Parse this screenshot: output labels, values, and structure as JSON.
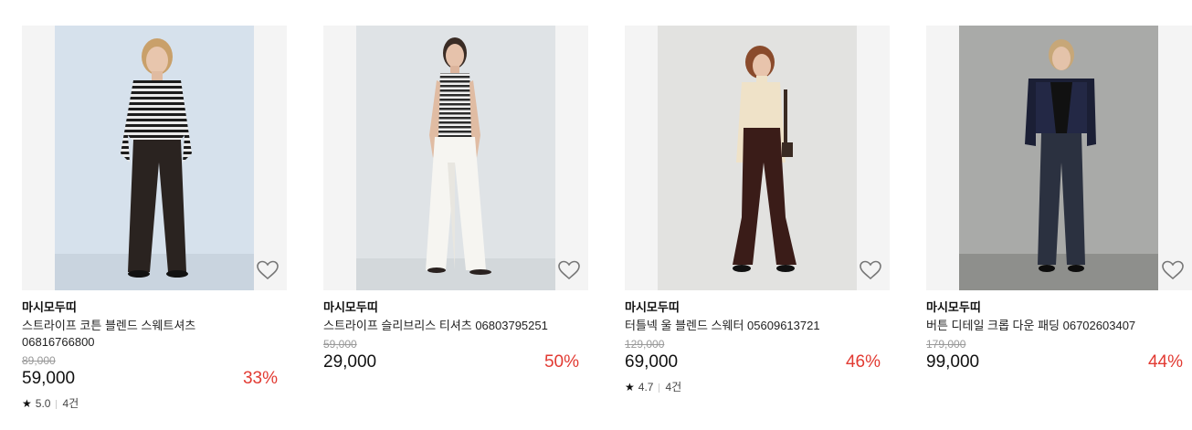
{
  "colors": {
    "discount": "#e23a32",
    "strike": "#999999",
    "thumb_bg": "#f4f4f4"
  },
  "products": [
    {
      "brand": "마시모두띠",
      "name": "스트라이프 코튼 블렌드 스웨트셔츠 06816766800",
      "original_price": "89,000",
      "price": "59,000",
      "discount": "33%",
      "rating": "5.0",
      "reviews": "4건",
      "wishlist_icon": "heart-outline-icon"
    },
    {
      "brand": "마시모두띠",
      "name": "스트라이프 슬리브리스 티셔츠 06803795251",
      "original_price": "59,000",
      "price": "29,000",
      "discount": "50%",
      "wishlist_icon": "heart-outline-icon"
    },
    {
      "brand": "마시모두띠",
      "name": "터틀넥 울 블렌드 스웨터 05609613721",
      "original_price": "129,000",
      "price": "69,000",
      "discount": "46%",
      "rating": "4.7",
      "reviews": "4건",
      "wishlist_icon": "heart-outline-icon"
    },
    {
      "brand": "마시모두띠",
      "name": "버튼 디테일 크롭 다운 패딩 06702603407",
      "original_price": "179,000",
      "price": "99,000",
      "discount": "44%",
      "wishlist_icon": "heart-outline-icon"
    }
  ]
}
